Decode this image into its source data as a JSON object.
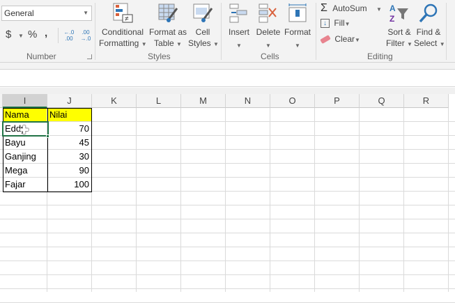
{
  "ribbon": {
    "number": {
      "format": "General",
      "currency": "$",
      "percent": "%",
      "comma": ",",
      "inc_decimal": "←.0 .00",
      "dec_decimal": ".00 →.0",
      "group_label": "Number"
    },
    "styles": {
      "conditional": [
        "Conditional",
        "Formatting"
      ],
      "format_table": [
        "Format as",
        "Table"
      ],
      "cell_styles": [
        "Cell",
        "Styles"
      ],
      "group_label": "Styles"
    },
    "cells": {
      "insert": "Insert",
      "delete": "Delete",
      "format": "Format",
      "group_label": "Cells"
    },
    "editing": {
      "autosum": "AutoSum",
      "fill": "Fill",
      "clear": "Clear",
      "sort": [
        "Sort &",
        "Filter"
      ],
      "find": [
        "Find &",
        "Select"
      ],
      "group_label": "Editing"
    }
  },
  "sheet": {
    "columns": [
      "I",
      "J",
      "K",
      "L",
      "M",
      "N",
      "O",
      "P",
      "Q",
      "R"
    ],
    "selected_column": "I",
    "headers": [
      "Nama",
      "Nilai"
    ],
    "rows": [
      [
        "Eddy",
        "70"
      ],
      [
        "Bayu",
        "45"
      ],
      [
        "Ganjing",
        "30"
      ],
      [
        "Mega",
        "90"
      ],
      [
        "Fajar",
        "100"
      ]
    ],
    "highlight_color": "#ffff00",
    "selection_color": "#217346"
  }
}
